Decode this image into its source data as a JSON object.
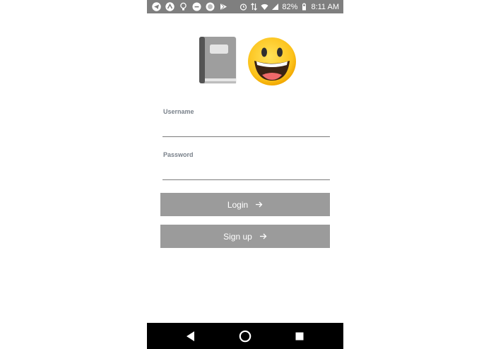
{
  "status_bar": {
    "battery": "82%",
    "time": "8:11 AM",
    "left_icons": [
      "telegram-icon",
      "arrow-circle-icon",
      "bulb-icon",
      "minus-circle-icon",
      "record-icon",
      "play-store-icon"
    ],
    "right_icons": [
      "alarm-icon",
      "data-arrows-icon",
      "wifi-icon",
      "signal-icon",
      "battery-icon"
    ]
  },
  "hero": {
    "book_icon": "notebook-emoji",
    "face_icon": "grinning-face-emoji"
  },
  "form": {
    "username_label": "Username",
    "username_value": "",
    "password_label": "Password",
    "password_value": "",
    "login_label": "Login",
    "signup_label": "Sign up"
  },
  "nav_bar": {
    "buttons": [
      "back-icon",
      "home-icon",
      "recents-icon"
    ]
  },
  "colors": {
    "status_bar": "#7f7f7f",
    "button": "#9b9b9b",
    "label": "#79818a",
    "nav_bar": "#000000"
  }
}
